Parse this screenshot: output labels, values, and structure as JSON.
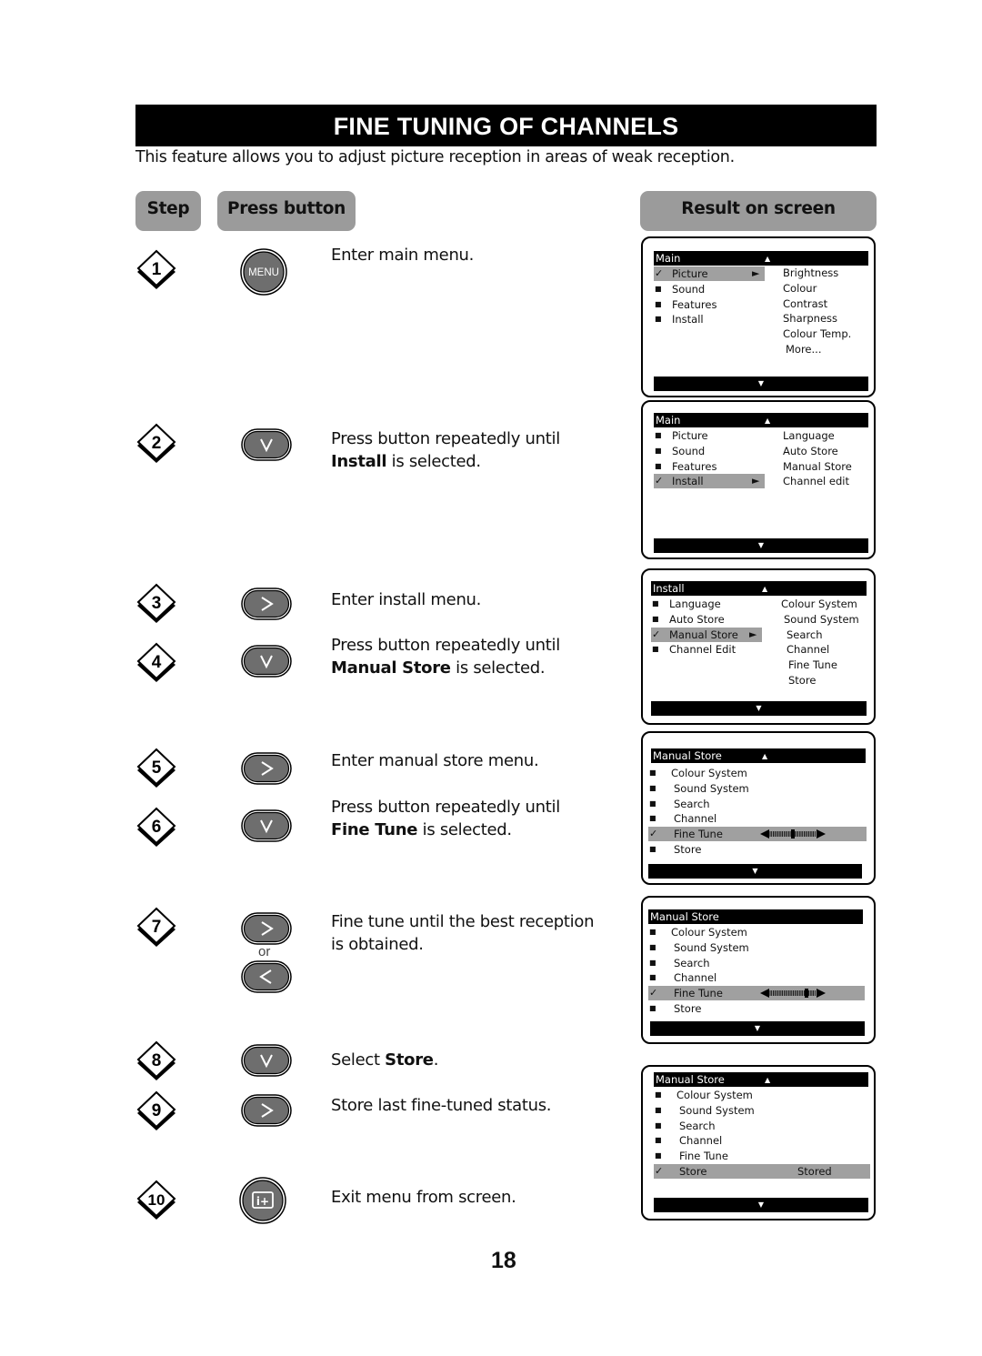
{
  "title": "FINE TUNING OF CHANNELS",
  "intro": "This feature allows you to adjust picture reception in areas of weak reception.",
  "headers": {
    "step": "Step",
    "press": "Press button",
    "result": "Result on screen"
  },
  "steps": [
    {
      "num": "1",
      "button": "menu-button",
      "button_label": "MENU",
      "text_pre": "Enter main menu.",
      "bold": "",
      "text_post": ""
    },
    {
      "num": "2",
      "button": "down-button",
      "text_pre": "Press button repeatedly until",
      "bold": "Install",
      "text_post": " is selected."
    },
    {
      "num": "3",
      "button": "right-button",
      "text_pre": "Enter install menu.",
      "bold": "",
      "text_post": ""
    },
    {
      "num": "4",
      "button": "down-button",
      "text_pre": "Press button repeatedly until",
      "bold": "Manual Store",
      "text_post": " is selected."
    },
    {
      "num": "5",
      "button": "right-button",
      "text_pre": "Enter manual store menu.",
      "bold": "",
      "text_post": ""
    },
    {
      "num": "6",
      "button": "down-button",
      "text_pre": "Press button repeatedly until",
      "bold": "Fine Tune",
      "text_post": " is selected."
    },
    {
      "num": "7",
      "button": "right-or-left-button",
      "or_label": "or",
      "text_pre": "Fine tune until the best reception",
      "text_line2": "is obtained."
    },
    {
      "num": "8",
      "button": "down-button",
      "text_pre": "Select ",
      "bold": "Store",
      "text_post": "."
    },
    {
      "num": "9",
      "button": "right-button",
      "text_pre": "Store last fine-tuned status."
    },
    {
      "num": "10",
      "button": "info-button",
      "button_label": "i+",
      "text_pre": "Exit menu from screen."
    }
  ],
  "screens": [
    {
      "header": "Main",
      "items": [
        "Picture",
        "Sound",
        "Features",
        "Install"
      ],
      "selected": 0,
      "submenu": [
        "Brightness",
        "Colour",
        "Contrast",
        "Sharpness",
        "Colour Temp.",
        "More..."
      ]
    },
    {
      "header": "Main",
      "items": [
        "Picture",
        "Sound",
        "Features",
        "Install"
      ],
      "selected": 3,
      "submenu": [
        "Language",
        "Auto Store",
        "Manual Store",
        "Channel edit"
      ]
    },
    {
      "header": "Install",
      "items": [
        "Language",
        "Auto Store",
        "Manual Store",
        "Channel Edit"
      ],
      "selected": 2,
      "submenu": [
        "Colour System",
        "Sound System",
        "Search",
        "Channel",
        "Fine Tune",
        "Store"
      ]
    },
    {
      "header": "Manual Store",
      "items": [
        "Colour System",
        "Sound System",
        "Search",
        "Channel",
        "Fine Tune",
        "Store"
      ],
      "selected": 4,
      "fine_tune_position": 0.5
    },
    {
      "header": "Manual Store",
      "items": [
        "Colour System",
        "Sound System",
        "Search",
        "Channel",
        "Fine Tune",
        "Store"
      ],
      "selected": 4,
      "fine_tune_position": 0.8
    },
    {
      "header": "Manual Store",
      "items": [
        "Colour System",
        "Sound System",
        "Search",
        "Channel",
        "Fine Tune",
        "Store"
      ],
      "selected": 5,
      "status": "Stored"
    }
  ],
  "page_number": "18"
}
